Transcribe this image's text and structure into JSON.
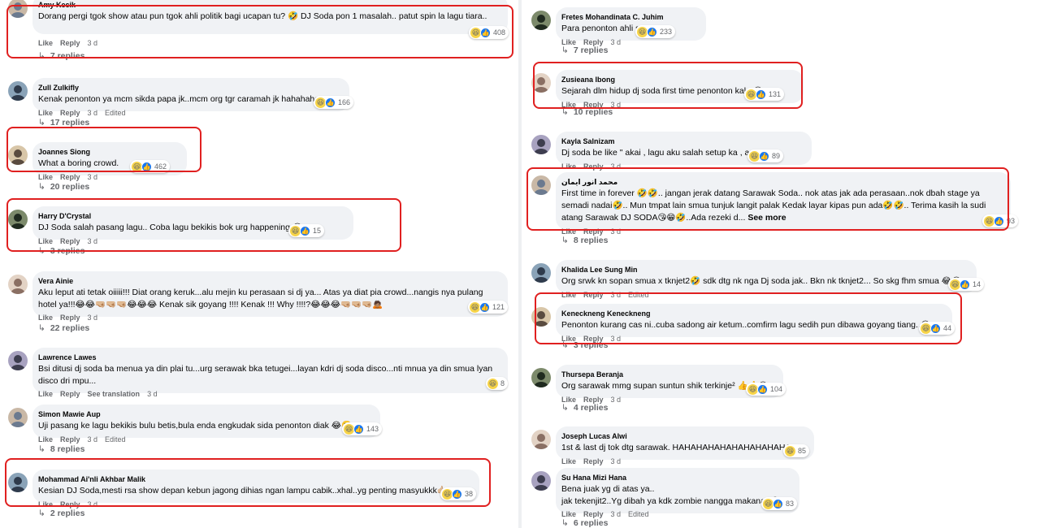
{
  "ui": {
    "like": "Like",
    "reply": "Reply",
    "see_translation": "See translation",
    "see_more": "See more",
    "edited": "Edited",
    "reply_arrow": "↳",
    "colors": {
      "bubble": "#f0f2f5",
      "highlight": "#e02020",
      "meta": "#65676b",
      "like_blue": "#1877f2"
    }
  },
  "left_comments": [
    {
      "name": "Amy Kecik",
      "text": "Dorang pergi tgok show atau pun tgok ahli politik bagi ucapan tu? 🤣 DJ Soda pon 1 masalah.. patut spin la lagu tiara..",
      "time": "3 d",
      "reactions": [
        "haha-icon",
        "like-icon"
      ],
      "count": "408",
      "replies": "7 replies",
      "highlighted": true
    },
    {
      "name": "Zull Zulkifly",
      "text": "Kenak penonton ya mcm sikda papa jk..mcm org tgr caramah jk hahahahaa..",
      "time": "3 d",
      "edited": true,
      "reactions": [
        "haha-icon",
        "like-icon"
      ],
      "count": "166",
      "replies": "17 replies"
    },
    {
      "name": "Joannes Siong",
      "text": "What a boring crowd.",
      "time": "3 d",
      "reactions": [
        "haha-icon",
        "like-icon"
      ],
      "count": "462",
      "replies": "20 replies",
      "highlighted": true
    },
    {
      "name": "Harry D'Crystal",
      "text": "DJ Soda salah pasang lagu.. Coba lagu bekikis bok urg happening 😂",
      "time": "3 d",
      "reactions": [
        "haha-icon",
        "like-icon"
      ],
      "count": "15",
      "replies": "3 replies",
      "highlighted": true
    },
    {
      "name": "Vera Ainie",
      "text": "Aku leput ati tetak oiiiii!!! Diat orang keruk...alu mejin ku perasaan si dj ya... Atas ya diat pia crowd...nangis nya pulang hotel ya!!!😂😂🤜🏼🤜🏼🤜🏼😂😂😂 Kenak sik goyang !!!! Kenak !!! Why !!!!?😂😂😂🤜🏼🤜🏼🤜🏼🙇🏽",
      "time": "3 d",
      "reactions": [
        "haha-icon",
        "like-icon"
      ],
      "count": "121",
      "replies": "22 replies"
    },
    {
      "name": "Lawrence Lawes",
      "text": "Bsi ditusi dj soda ba menua ya din plai tu...urg serawak bka tetugei...layan kdri dj soda disco...nti mnua ya din smua lyan disco dri mpu...",
      "time": "3 d",
      "translation": true,
      "reactions": [
        "haha-icon"
      ],
      "count": "8"
    },
    {
      "name": "Simon Mawie Aup",
      "text": "Uji pasang ke lagu bekikis bulu betis,bula enda engkudak sida penonton diak 😂🤭",
      "time": "3 d",
      "edited": true,
      "reactions": [
        "haha-icon",
        "like-icon"
      ],
      "count": "143",
      "replies": "8 replies"
    },
    {
      "name": "Mohammad Ai'nli Akhbar Malik",
      "text": "Kesian DJ Soda,mesti rsa show depan kebun jagong dihias ngan lampu cabik..xhal..yg penting masyukkk🤙🏼",
      "time": "3 d",
      "reactions": [
        "haha-icon",
        "like-icon"
      ],
      "count": "38",
      "replies": "2 replies",
      "highlighted": true
    }
  ],
  "right_comments": [
    {
      "name": "Fretes Mohandinata C. Juhim",
      "text": "Para penonton ahli syurga",
      "time": "3 d",
      "reactions": [
        "haha-icon",
        "like-icon"
      ],
      "count": "233",
      "replies": "7 replies"
    },
    {
      "name": "Zusieana Ibong",
      "text": "Sejarah dlm hidup dj soda first time penonton kaku😂",
      "time": "3 d",
      "reactions": [
        "haha-icon",
        "like-icon"
      ],
      "count": "131",
      "replies": "10 replies",
      "highlighted": true
    },
    {
      "name": "Kayla Salnizam",
      "text": "Dj soda be like \" akai , lagu aku salah setup ka , apuu \"",
      "time": "3 d",
      "reactions": [
        "haha-icon",
        "like-icon"
      ],
      "count": "89"
    },
    {
      "name": "محمد انور ايمان",
      "text": "First time in forever 🤣🤣.. jangan jerak datang Sarawak Soda.. nok atas jak ada perasaan..nok dbah stage ya semadi nadai🤣.. Mun tmpat lain smua tunjuk langit palak Kedak layar kipas pun ada🤣🤣.. Terima kasih la sudi atang Sarawak DJ SODA😘😁🤣..Ada rezeki d...",
      "time": "3 d",
      "see_more": true,
      "reactions": [
        "haha-icon",
        "like-icon"
      ],
      "count": "93",
      "replies": "8 replies",
      "highlighted": true
    },
    {
      "name": "Khalida Lee Sung Min",
      "text": "Org srwk kn sopan smua x tknjet2🤣 sdk dtg nk nga Dj soda jak.. Bkn nk tknjet2... So skg fhm smua 😂😂",
      "time": "3 d",
      "edited": true,
      "reactions": [
        "haha-icon",
        "like-icon"
      ],
      "count": "14"
    },
    {
      "name": "Keneckneng Keneckneng",
      "text": "Penonton kurang cas ni..cuba sadong air ketum..comfirm lagu sedih pun dibawa goyang tiang..😂",
      "time": "3 d",
      "reactions": [
        "haha-icon",
        "like-icon"
      ],
      "count": "44",
      "replies": "3 replies",
      "highlighted": true
    },
    {
      "name": "Thursepa Beranja",
      "text": "Org sarawak mmg supan suntun shik terkinje² 👍👍😁",
      "time": "3 d",
      "reactions": [
        "haha-icon",
        "like-icon"
      ],
      "count": "104",
      "replies": "4 replies"
    },
    {
      "name": "Joseph Lucas Alwi",
      "text": "1st & last dj tok dtg sarawak. HAHAHAHAHAHAHAHAHAHA",
      "time": "3 d",
      "reactions": [
        "haha-icon"
      ],
      "count": "85"
    },
    {
      "name": "Su Hana Mizi Hana",
      "text": "Bena juak yg di atas ya..\njak tekenjit2..Yg dibah ya kdk zombie nangga makanan😂",
      "time": "3 d",
      "edited": true,
      "reactions": [
        "haha-icon",
        "like-icon"
      ],
      "count": "83",
      "replies": "6 replies"
    }
  ]
}
